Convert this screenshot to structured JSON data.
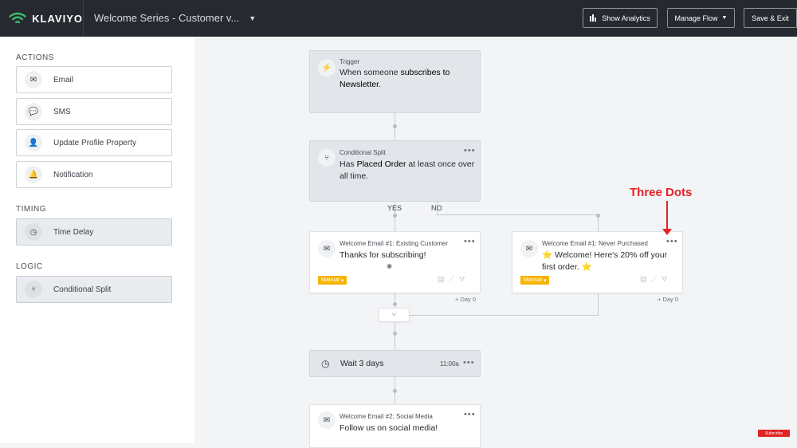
{
  "topbar": {
    "logo_text": "KLAVIYO",
    "flow_title": "Welcome Series - Customer v...",
    "show_analytics": "Show Analytics",
    "manage_flow": "Manage Flow",
    "save_exit": "Save & Exit"
  },
  "sidebar": {
    "actions_title": "ACTIONS",
    "actions": [
      "Email",
      "SMS",
      "Update Profile Property",
      "Notification"
    ],
    "timing_title": "TIMING",
    "timing": [
      "Time Delay"
    ],
    "logic_title": "LOGIC",
    "logic": [
      "Conditional Split"
    ]
  },
  "flow": {
    "trigger_label": "Trigger",
    "trigger_text_1": "When someone ",
    "trigger_text_bold": "subscribes to",
    "trigger_text_2": "Newsletter",
    "trigger_text_end": ".",
    "split_label": "Conditional Split",
    "split_text_1": "Has ",
    "split_text_bold": "Placed Order",
    "split_text_2": " at least once over",
    "split_text_3": "all time.",
    "yes": "YES",
    "no": "NO",
    "email1_label": "Welcome Email #1: Existing Customer",
    "email1_text": "Thanks for subscribing!",
    "email1_badge": "Manual",
    "email1_day": "+ Day 0",
    "email2_label": "Welcome Email #1: Never Purchased",
    "email2_text_1": "⭐ Welcome! Here's 20% off your",
    "email2_text_2": "first order. ⭐",
    "email2_badge": "Manual",
    "email2_day": "+ Day 0",
    "wait_text": "Wait 3 days",
    "wait_time": "11:00a",
    "email3_label": "Welcome Email #2: Social Media",
    "email3_text": "Follow us on social media!",
    "dots": "•••"
  },
  "annotation": {
    "text": "Three Dots"
  },
  "youtube_badge": "Subscribe",
  "colors": {
    "topbar": "#262a30",
    "badge": "#f6b400",
    "annotation": "#e02424"
  }
}
